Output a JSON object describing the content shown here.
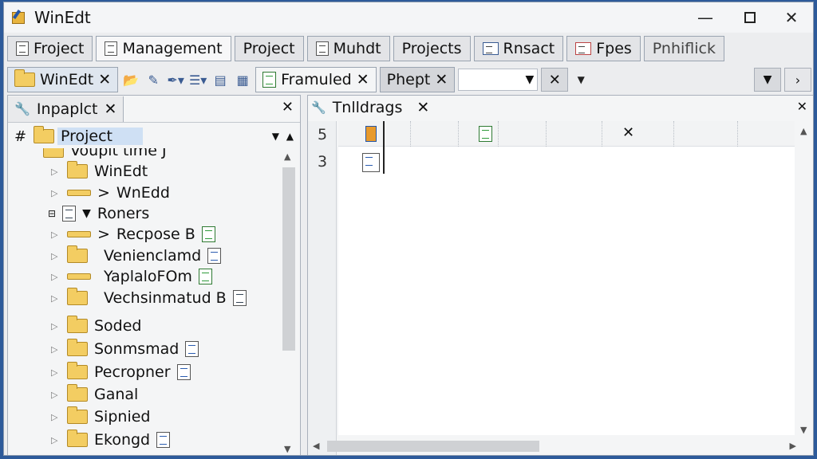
{
  "window": {
    "title": "WinEdt"
  },
  "tabs_row1": [
    {
      "label": "Froject"
    },
    {
      "label": "Management"
    },
    {
      "label": "Project"
    },
    {
      "label": "Muhdt"
    },
    {
      "label": "Projects"
    },
    {
      "label": "Rnsact"
    },
    {
      "label": "Fpes"
    },
    {
      "label": "Pnhiflick"
    }
  ],
  "tabs_row2": [
    {
      "label": "WinEdt",
      "close": "✕"
    },
    {
      "label": "Framuled",
      "close": "✕"
    },
    {
      "label": "Phept",
      "close": "✕"
    }
  ],
  "toolbar": {
    "combo_value": "",
    "close": "✕"
  },
  "left_panel": {
    "tab_label": "Inpaplct",
    "close": "✕",
    "hash": "#",
    "root_label": "Project",
    "tree": [
      {
        "label": "Vouplt tlme J"
      },
      {
        "label": "WinEdt"
      },
      {
        "label": "WnEdd",
        "prefix": ">"
      },
      {
        "label": "Roners",
        "prefix": "▼"
      },
      {
        "label": "Recpose B",
        "prefix": ">"
      },
      {
        "label": "Venienclamd"
      },
      {
        "label": "YaplaloFOm"
      },
      {
        "label": "Vechsinmatud B"
      },
      {
        "label": "Soded"
      },
      {
        "label": "Sonmsmad"
      },
      {
        "label": "Pecropner"
      },
      {
        "label": "Ganal"
      },
      {
        "label": "Sipnied"
      },
      {
        "label": "Ekongd"
      }
    ]
  },
  "editor": {
    "tab_label": "Tnlldrags",
    "close": "✕",
    "line_numbers": [
      "5",
      "3"
    ],
    "ruler_close": "✕"
  },
  "icons": {
    "app": "winedt-app-icon",
    "minimize": "minimize-icon",
    "maximize": "maximize-icon",
    "close": "close-icon"
  }
}
